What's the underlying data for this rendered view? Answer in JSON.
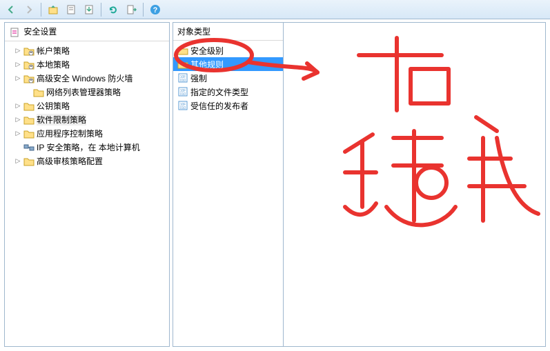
{
  "toolbar": {
    "icons": [
      "back",
      "forward",
      "up",
      "properties",
      "export",
      "refresh",
      "export-list",
      "help"
    ]
  },
  "left": {
    "header": "安全设置",
    "items": [
      {
        "label": "帐户策略",
        "icon": "folder-lock",
        "expandable": true
      },
      {
        "label": "本地策略",
        "icon": "folder-lock",
        "expandable": true
      },
      {
        "label": "高级安全 Windows 防火墙",
        "icon": "folder-lock",
        "expandable": true
      },
      {
        "label": "网络列表管理器策略",
        "icon": "folder",
        "expandable": false,
        "indent": true
      },
      {
        "label": "公钥策略",
        "icon": "folder",
        "expandable": true
      },
      {
        "label": "软件限制策略",
        "icon": "folder",
        "expandable": true,
        "selected": true
      },
      {
        "label": "应用程序控制策略",
        "icon": "folder",
        "expandable": true
      },
      {
        "label": "IP 安全策略，在 本地计算机",
        "icon": "ipsec",
        "expandable": false
      },
      {
        "label": "高级审核策略配置",
        "icon": "folder",
        "expandable": true
      }
    ]
  },
  "right": {
    "header": "对象类型",
    "items": [
      {
        "label": "安全级别",
        "icon": "folder",
        "selected": false
      },
      {
        "label": "其他规则",
        "icon": "folder",
        "selected": true
      },
      {
        "label": "强制",
        "icon": "registry",
        "selected": false
      },
      {
        "label": "指定的文件类型",
        "icon": "registry",
        "selected": false
      },
      {
        "label": "受信任的发布者",
        "icon": "registry",
        "selected": false
      }
    ]
  },
  "annotation_text": "右键"
}
